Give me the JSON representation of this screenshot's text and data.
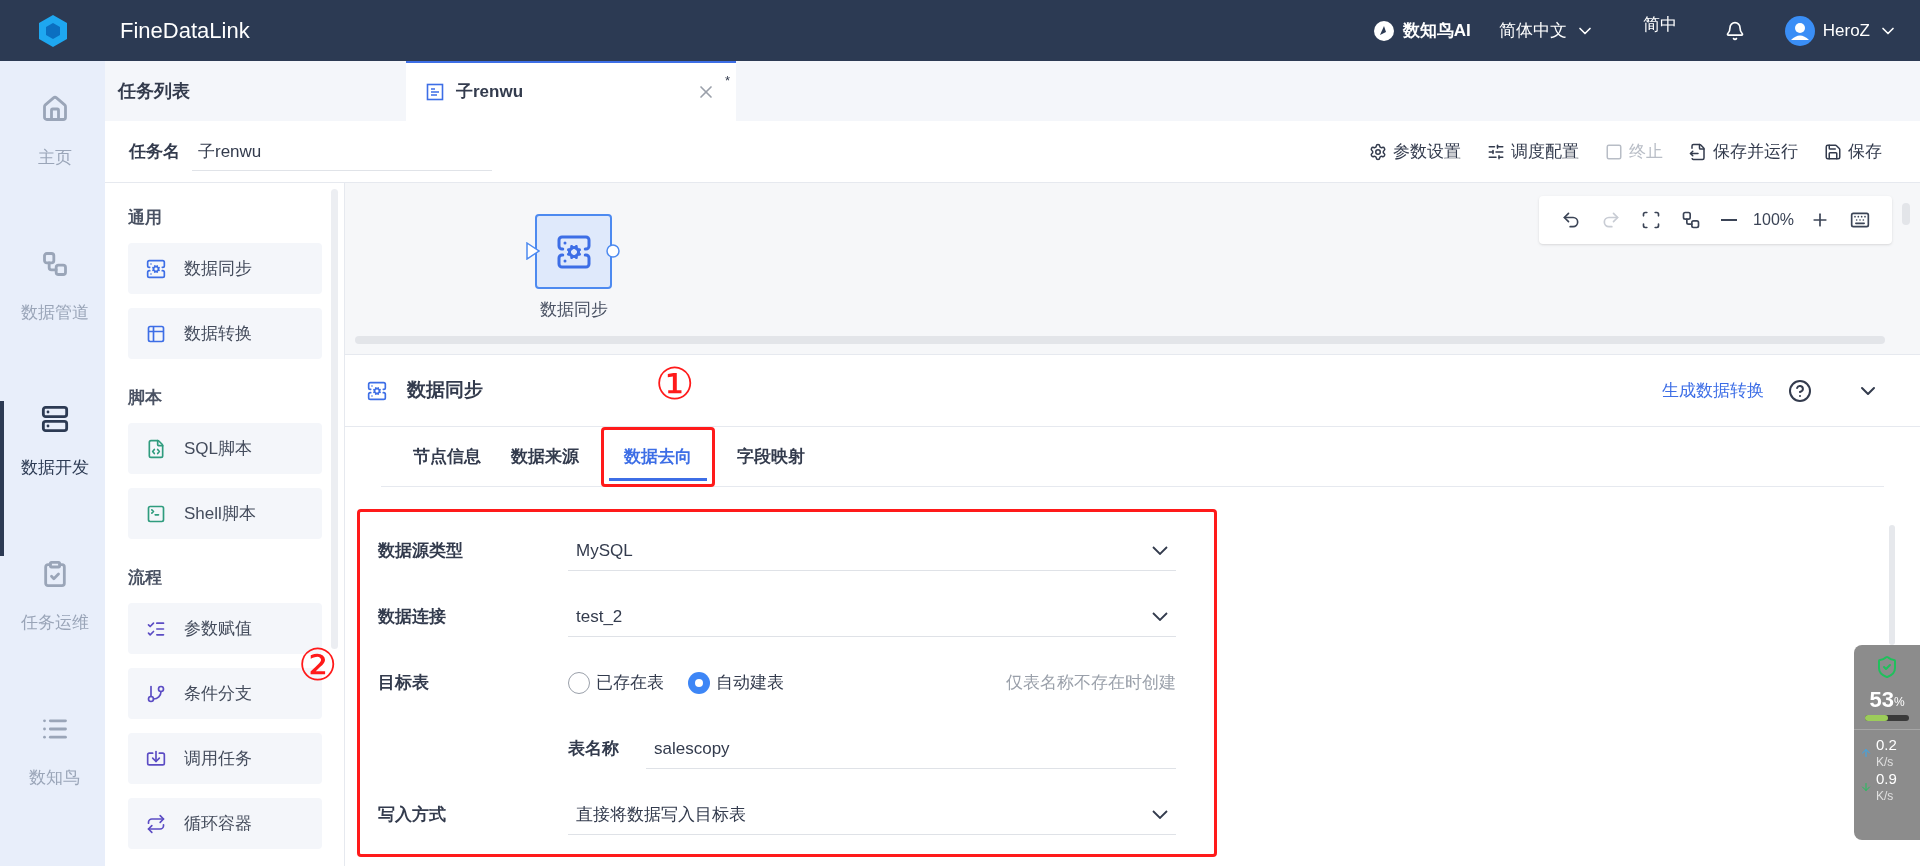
{
  "header": {
    "product": "FineDataLink",
    "ai": "数知鸟AI",
    "language": "简体中文",
    "short_lang": "简中",
    "user": "HeroZ"
  },
  "nav": [
    {
      "kind": "home",
      "label": "主页",
      "selected": false
    },
    {
      "kind": "pipeline",
      "label": "数据管道",
      "selected": false
    },
    {
      "kind": "dev",
      "label": "数据开发",
      "selected": true
    },
    {
      "kind": "ops",
      "label": "任务运维",
      "selected": false
    },
    {
      "kind": "list",
      "label": "数知鸟",
      "selected": false
    }
  ],
  "task_list_title": "任务列表",
  "tabs": [
    {
      "label": "子renwu",
      "modified_mark": "*",
      "selected": true
    }
  ],
  "task_name": {
    "label": "任务名",
    "value": "子renwu"
  },
  "actions": [
    {
      "kind": "settings",
      "label": "参数设置",
      "disabled": false
    },
    {
      "kind": "schedule",
      "label": "调度配置",
      "disabled": false
    },
    {
      "kind": "stop",
      "label": "终止",
      "disabled": true
    },
    {
      "kind": "run",
      "label": "保存并运行",
      "disabled": false
    },
    {
      "kind": "save",
      "label": "保存",
      "disabled": false
    }
  ],
  "components": [
    {
      "title": "通用",
      "items": [
        {
          "kind": "sync",
          "label": "数据同步"
        },
        {
          "kind": "transform",
          "label": "数据转换"
        }
      ]
    },
    {
      "title": "脚本",
      "items": [
        {
          "kind": "sql",
          "label": "SQL脚本"
        },
        {
          "kind": "shell",
          "label": "Shell脚本"
        }
      ]
    },
    {
      "title": "流程",
      "items": [
        {
          "kind": "param",
          "label": "参数赋值"
        },
        {
          "kind": "branch",
          "label": "条件分支"
        },
        {
          "kind": "call",
          "label": "调用任务"
        },
        {
          "kind": "loop",
          "label": "循环容器"
        }
      ]
    }
  ],
  "canvas": {
    "node": {
      "label": "数据同步"
    },
    "zoom": "100%",
    "tools": [
      {
        "kind": "undo",
        "disabled": false
      },
      {
        "kind": "redo",
        "disabled": true
      },
      {
        "kind": "fit",
        "disabled": false
      },
      {
        "kind": "layout",
        "disabled": false
      },
      {
        "kind": "zoom_out",
        "disabled": false
      },
      {
        "kind": "zoom_in",
        "disabled": false
      },
      {
        "kind": "keyboard",
        "disabled": false
      }
    ]
  },
  "panel": {
    "title": "数据同步",
    "link": "生成数据转换",
    "tabs": [
      {
        "label": "节点信息",
        "selected": false
      },
      {
        "label": "数据来源",
        "selected": false
      },
      {
        "label": "数据去向",
        "selected": true
      },
      {
        "label": "字段映射",
        "selected": false
      }
    ],
    "fields": [
      {
        "kind": "select",
        "label": "数据源类型",
        "value": "MySQL"
      },
      {
        "kind": "select",
        "label": "数据连接",
        "value": "test_2"
      },
      {
        "kind": "radio",
        "label": "目标表",
        "options": [
          {
            "label": "已存在表",
            "selected": false
          },
          {
            "label": "自动建表",
            "selected": true
          }
        ],
        "hint": "仅表名称不存在时创建"
      },
      {
        "kind": "text",
        "label": "表名称",
        "value": "salescopy"
      },
      {
        "kind": "select",
        "label": "写入方式",
        "value": "直接将数据写入目标表"
      }
    ]
  },
  "annotations": [
    "①",
    "②"
  ],
  "monitor": {
    "percent": "53",
    "unit": "%",
    "level": 0.53,
    "upload": "0.2",
    "download": "0.9",
    "upload_unit": "K/s",
    "download_unit": "K/s"
  }
}
